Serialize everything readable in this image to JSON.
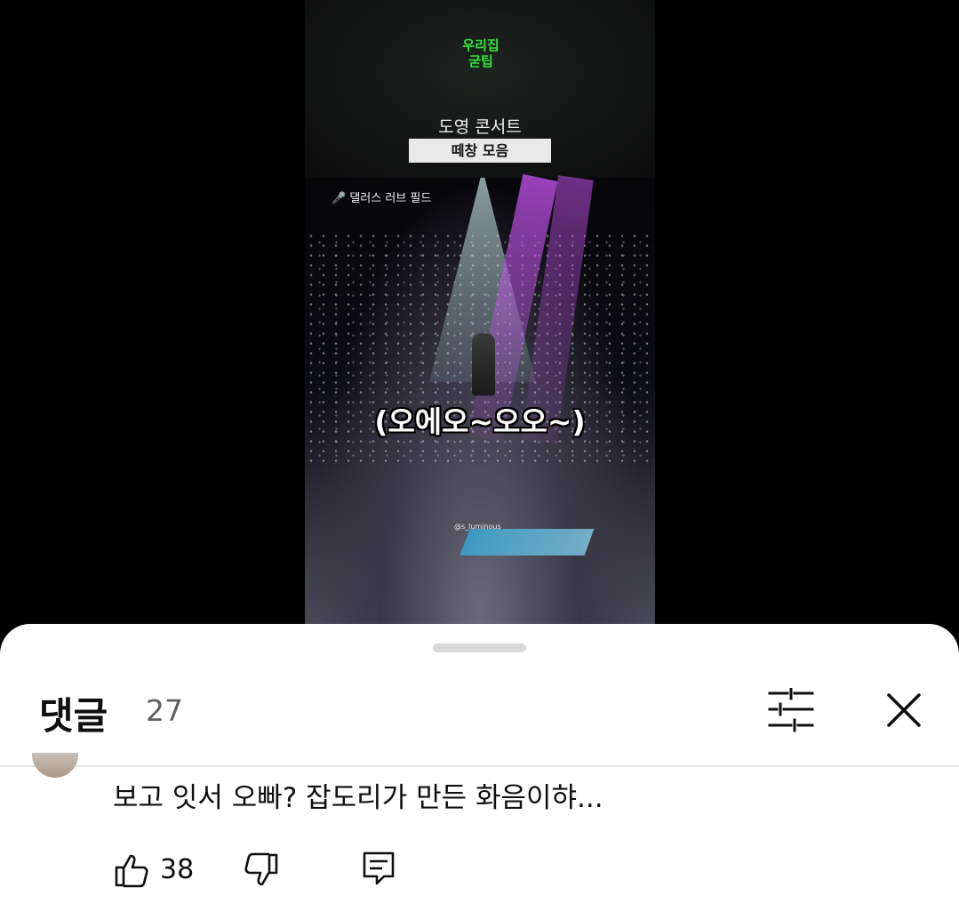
{
  "video": {
    "logo_line1": "우리집",
    "logo_line2": "굳팁",
    "concert_title": "도영 콘서트",
    "concert_subtitle": "떼창 모음",
    "location_label": "🎤 댈러스 러브 필드",
    "lyrics": "(오에오~오오~)",
    "watermark": "@s_luminous"
  },
  "comments_sheet": {
    "title": "댓글",
    "count": "27",
    "icons": {
      "sort": "sort-filter-icon",
      "close": "close-icon"
    }
  },
  "comment": {
    "text": "보고 잇서 오빠? 잡도리가 만든 화음이햐...",
    "like_count": "38",
    "icons": {
      "like": "thumbs-up-icon",
      "dislike": "thumbs-down-icon",
      "reply": "reply-icon"
    }
  }
}
